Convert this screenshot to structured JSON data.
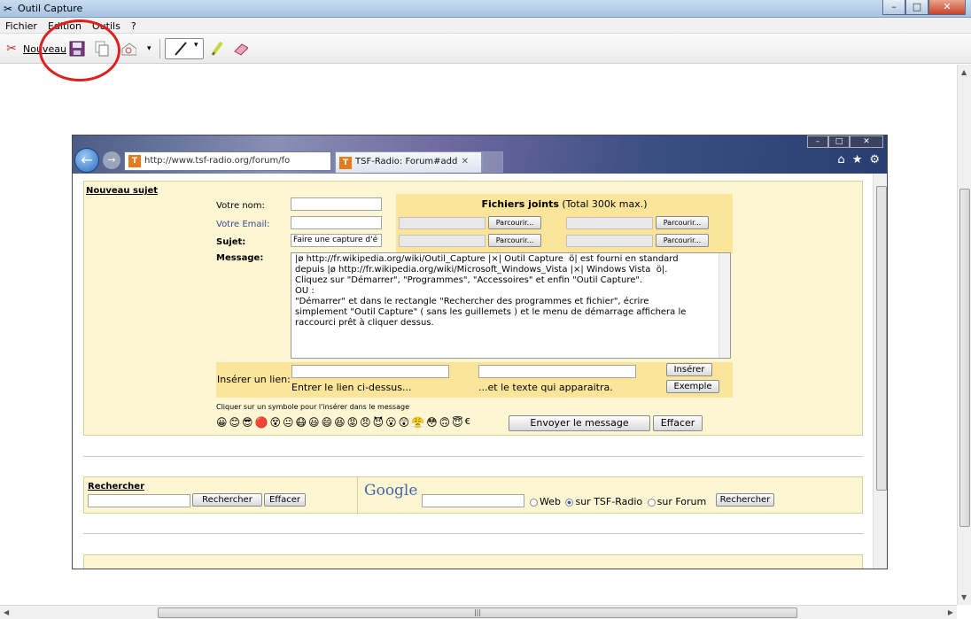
{
  "window": {
    "title": "Outil Capture",
    "controls": {
      "minimize": "–",
      "maximize": "□",
      "close": "✕"
    }
  },
  "menu": [
    "Fichier",
    "Edition",
    "Outils",
    "?"
  ],
  "toolbar": {
    "new_label": "Nouveau"
  },
  "browser": {
    "address": "http://www.tsf-radio.org/forum/fo",
    "tab_title": "TSF-Radio: Forum#add",
    "favicon": "T"
  },
  "form": {
    "section_title": "Nouveau sujet",
    "name_label": "Votre nom:",
    "email_label": "Votre Email:",
    "subject_label": "Sujet:",
    "subject_value": "Faire une capture d'é",
    "message_label": "Message:",
    "attachments_title": "Fichiers joints",
    "attachments_note": "(Total 300k max.)",
    "browse_label": "Parcourir...",
    "message_lines": [
      "|ø http://fr.wikipedia.org/wiki/Outil_Capture |×| Outil Capture  ö| est fourni en standard",
      "depuis |ø http://fr.wikipedia.org/wiki/Microsoft_Windows_Vista |×| Windows Vista  ö|.",
      "",
      "Cliquez sur \"Démarrer\", \"Programmes\", \"Accessoires\" et enfin \"Outil Capture\".",
      "",
      "OU :",
      "",
      "\"Démarrer\" et dans le rectangle \"Rechercher des programmes et fichier\", écrire",
      "simplement \"Outil Capture\" ( sans les guillemets ) et le menu de démarrage affichera le",
      "raccourci prêt à cliquer dessus."
    ],
    "link_label": "Insérer un lien:",
    "link_hint": "Entrer le lien ci-dessus...",
    "text_hint": "...et le texte qui apparaitra.",
    "insert_button": "Insérer",
    "example_button": "Exemple",
    "smiley_hint": "Cliquer sur un symbole pour l'insérer dans le message",
    "smileys": [
      "😀",
      "😊",
      "😎",
      "🔴",
      "😵",
      "😐",
      "😷",
      "😃",
      "😄",
      "😆",
      "😡",
      "😠",
      "😈",
      "😮",
      "😲",
      "😤",
      "😳",
      "🙃",
      "😇"
    ],
    "euro": "€",
    "send_button": "Envoyer le message",
    "clear_button": "Effacer"
  },
  "search": {
    "title": "Rechercher",
    "search_button": "Rechercher",
    "clear_button": "Effacer",
    "google_logo": "Google",
    "opt_web": "Web",
    "opt_site": "sur TSF-Radio",
    "opt_forum": "sur Forum",
    "google_button": "Rechercher"
  },
  "colors": {
    "annotation": "#e02020",
    "panel": "#fdf6d3",
    "files_panel": "#fbe59a"
  }
}
